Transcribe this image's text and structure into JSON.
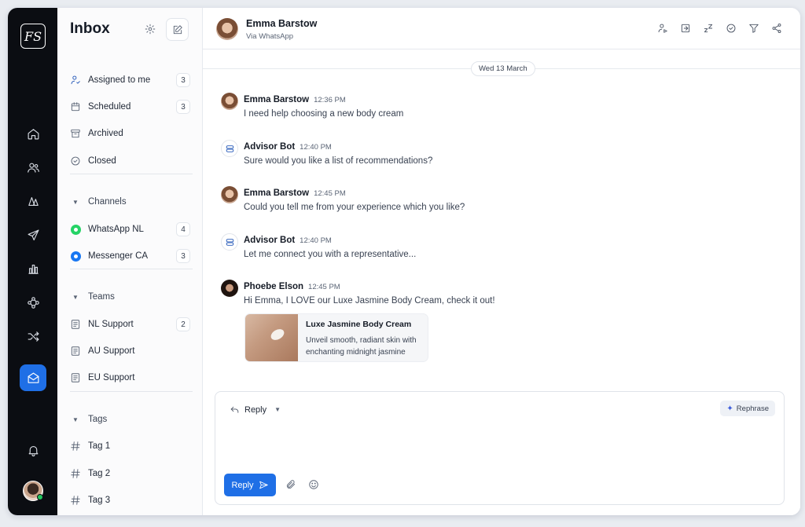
{
  "rail": {
    "logo_text": "FS",
    "nav": [
      "home-icon",
      "users-icon",
      "book-icon",
      "send-icon",
      "chart-icon",
      "integrations-icon",
      "shuffle-icon",
      "inbox-icon"
    ],
    "active": "inbox-icon"
  },
  "sidebar": {
    "title": "Inbox",
    "items": [
      {
        "label": "Assigned to me",
        "count": "3"
      },
      {
        "label": "Scheduled",
        "count": "3"
      },
      {
        "label": "Archived"
      },
      {
        "label": "Closed"
      }
    ],
    "channels_label": "Channels",
    "channels": [
      {
        "label": "WhatsApp NL",
        "count": "4"
      },
      {
        "label": "Messenger CA",
        "count": "3"
      }
    ],
    "teams_label": "Teams",
    "teams": [
      {
        "label": "NL Support",
        "count": "2"
      },
      {
        "label": "AU Support"
      },
      {
        "label": "EU Support"
      }
    ],
    "tags_label": "Tags",
    "tags": [
      {
        "label": "Tag 1"
      },
      {
        "label": "Tag 2"
      },
      {
        "label": "Tag 3"
      }
    ]
  },
  "conversation": {
    "contact_name": "Emma Barstow",
    "contact_sub": "Via WhatsApp",
    "date": "Wed 13 March",
    "messages": [
      {
        "author": "Emma Barstow",
        "time": "12:36 PM",
        "text": "I need help choosing a new body cream"
      },
      {
        "author": "Advisor Bot",
        "time": "12:40 PM",
        "text": "Sure would you like a list of recommendations?"
      },
      {
        "author": "Emma Barstow",
        "time": "12:45 PM",
        "text": "Could you tell me from your experience which you like?"
      },
      {
        "author": "Advisor Bot",
        "time": "12:40 PM",
        "text": "Let me connect you with a representative..."
      },
      {
        "author": "Phoebe Elson",
        "time": "12:45 PM",
        "text": "Hi Emma, I LOVE our Luxe Jasmine Body Cream, check it out!"
      }
    ],
    "card": {
      "title": "Luxe Jasmine Body Cream",
      "description": "Unveil smooth, radiant skin with enchanting midnight jasmine"
    }
  },
  "composer": {
    "mode_label": "Reply",
    "rephrase_label": "Rephrase",
    "send_label": "Reply"
  },
  "colors": {
    "accent": "#1f6fe6",
    "rail_bg": "#0b0d12",
    "presence": "#22c55e"
  }
}
